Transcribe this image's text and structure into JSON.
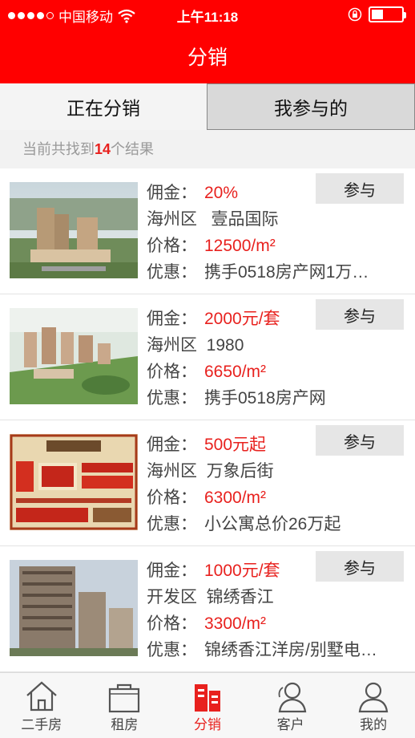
{
  "status": {
    "carrier": "中国移动",
    "time": "上午11:18"
  },
  "header": {
    "title": "分销"
  },
  "tabs": [
    {
      "label": "正在分销"
    },
    {
      "label": "我参与的"
    }
  ],
  "result": {
    "prefix": "当前共找到",
    "count": "14",
    "suffix": "个结果"
  },
  "labels": {
    "commission": "佣金：",
    "price": "价格：",
    "offer": "优惠：",
    "join": "参与"
  },
  "items": [
    {
      "commission": "20%",
      "district": "海州区",
      "name": "壹品国际",
      "price": "12500/m²",
      "offer": "携手0518房产网1万…"
    },
    {
      "commission": "2000元/套",
      "district": "海州区",
      "name": "1980",
      "price": "6650/m²",
      "offer": "携手0518房产网"
    },
    {
      "commission": "500元起",
      "district": "海州区",
      "name": "万象后街",
      "price": "6300/m²",
      "offer": "小公寓总价26万起"
    },
    {
      "commission": "1000元/套",
      "district": "开发区",
      "name": "锦绣香江",
      "price": "3300/m²",
      "offer": "锦绣香江洋房/别墅电…"
    }
  ],
  "nav": [
    {
      "label": "二手房",
      "icon": "house-icon"
    },
    {
      "label": "租房",
      "icon": "bag-icon"
    },
    {
      "label": "分销",
      "icon": "distribution-icon"
    },
    {
      "label": "客户",
      "icon": "customers-icon"
    },
    {
      "label": "我的",
      "icon": "profile-icon"
    }
  ],
  "colors": {
    "brand": "#ff0000",
    "accent": "#e8211e"
  }
}
